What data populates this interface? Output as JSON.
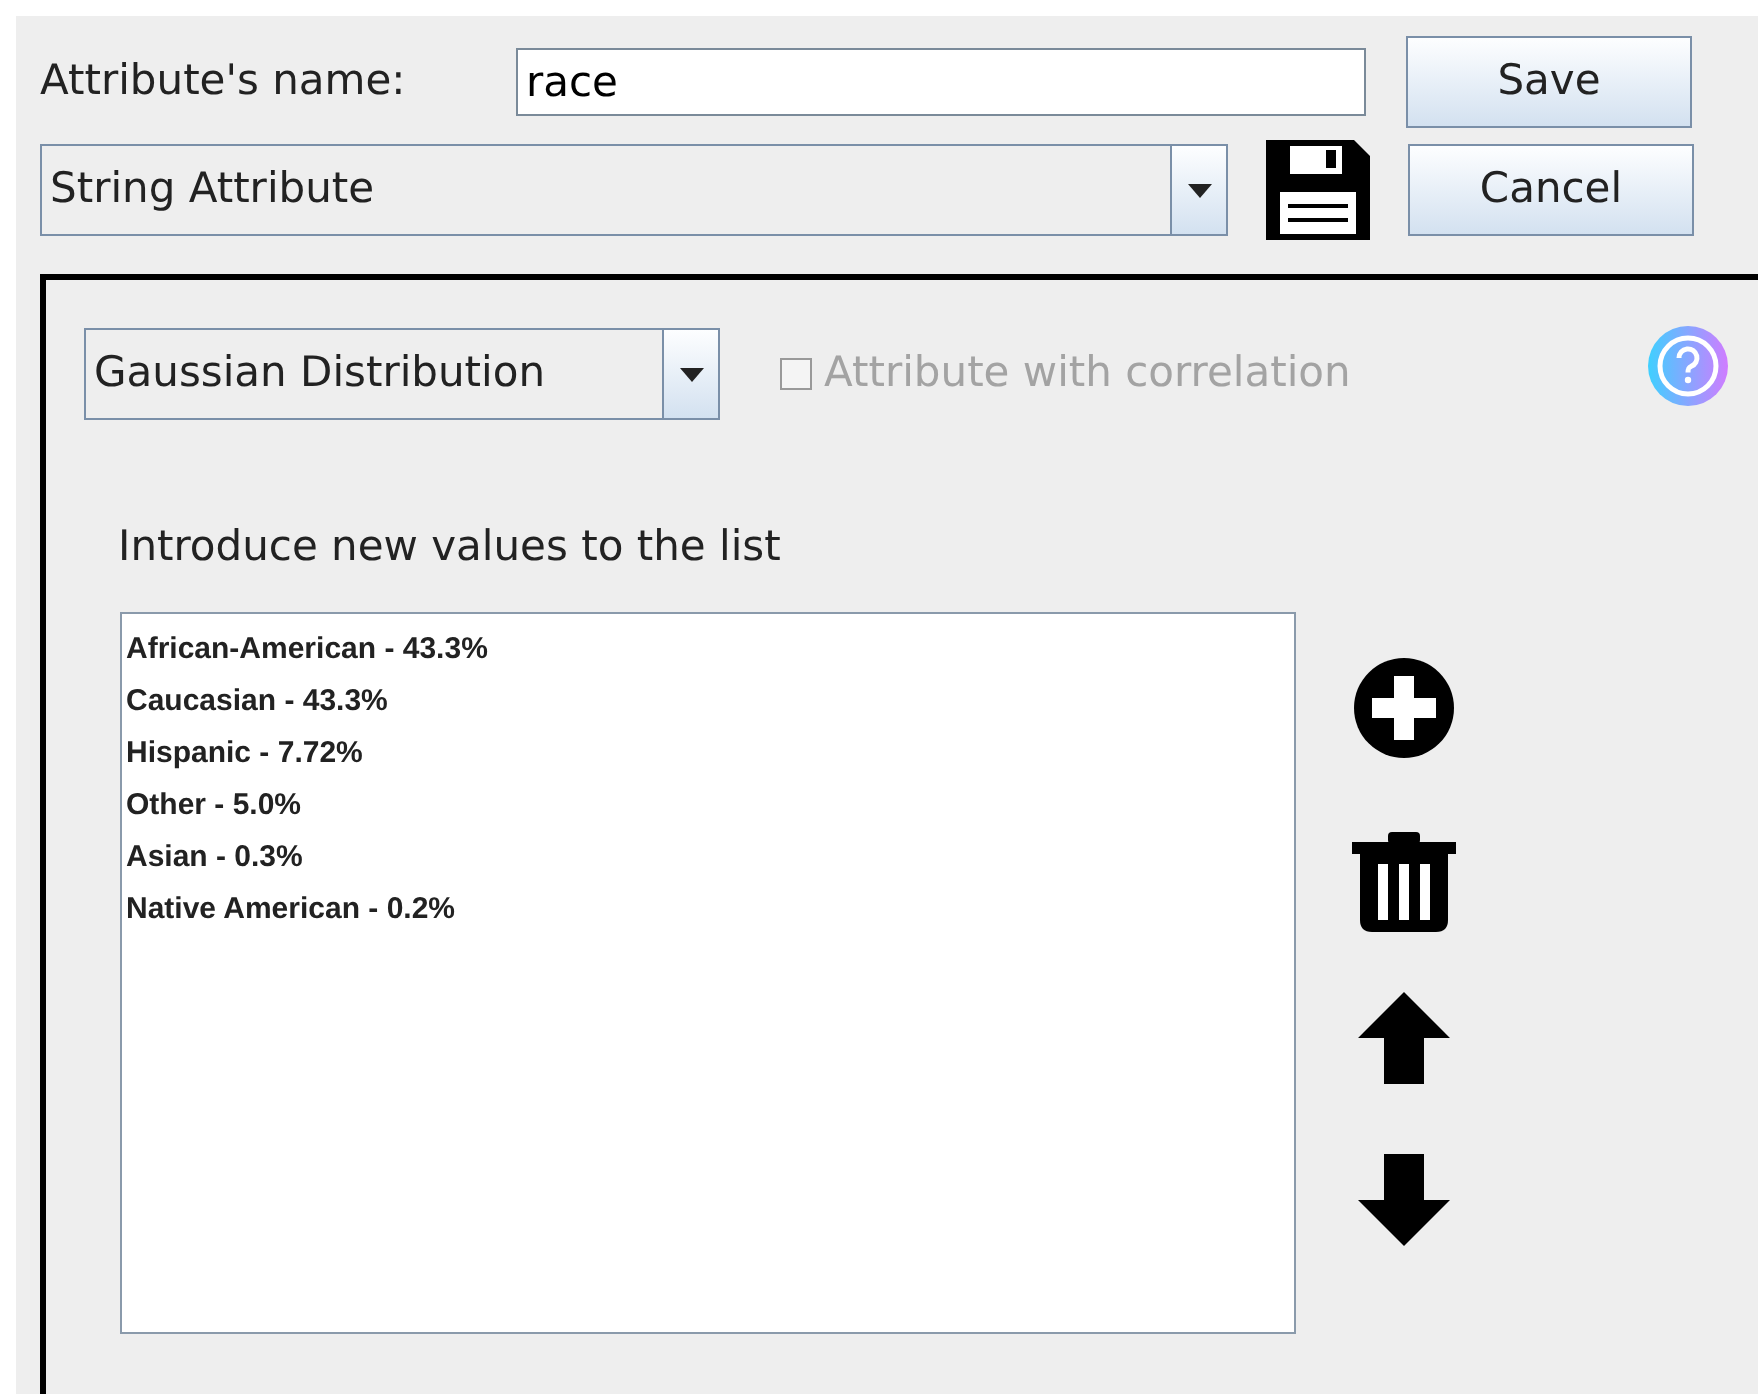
{
  "name_label": "Attribute's name:",
  "name_value": "race",
  "save_button": "Save",
  "cancel_button": "Cancel",
  "attribute_type": "String Attribute",
  "distribution": "Gaussian Distribution",
  "correlation": {
    "label": "Attribute with correlation",
    "checked": false,
    "disabled": true
  },
  "values_label": "Introduce new values to the list",
  "values": [
    {
      "label": "African-American - 43.3%"
    },
    {
      "label": "Caucasian - 43.3%"
    },
    {
      "label": "Hispanic - 7.72%"
    },
    {
      "label": "Other - 5.0%"
    },
    {
      "label": "Asian - 0.3%"
    },
    {
      "label": "Native American - 0.2%"
    }
  ]
}
